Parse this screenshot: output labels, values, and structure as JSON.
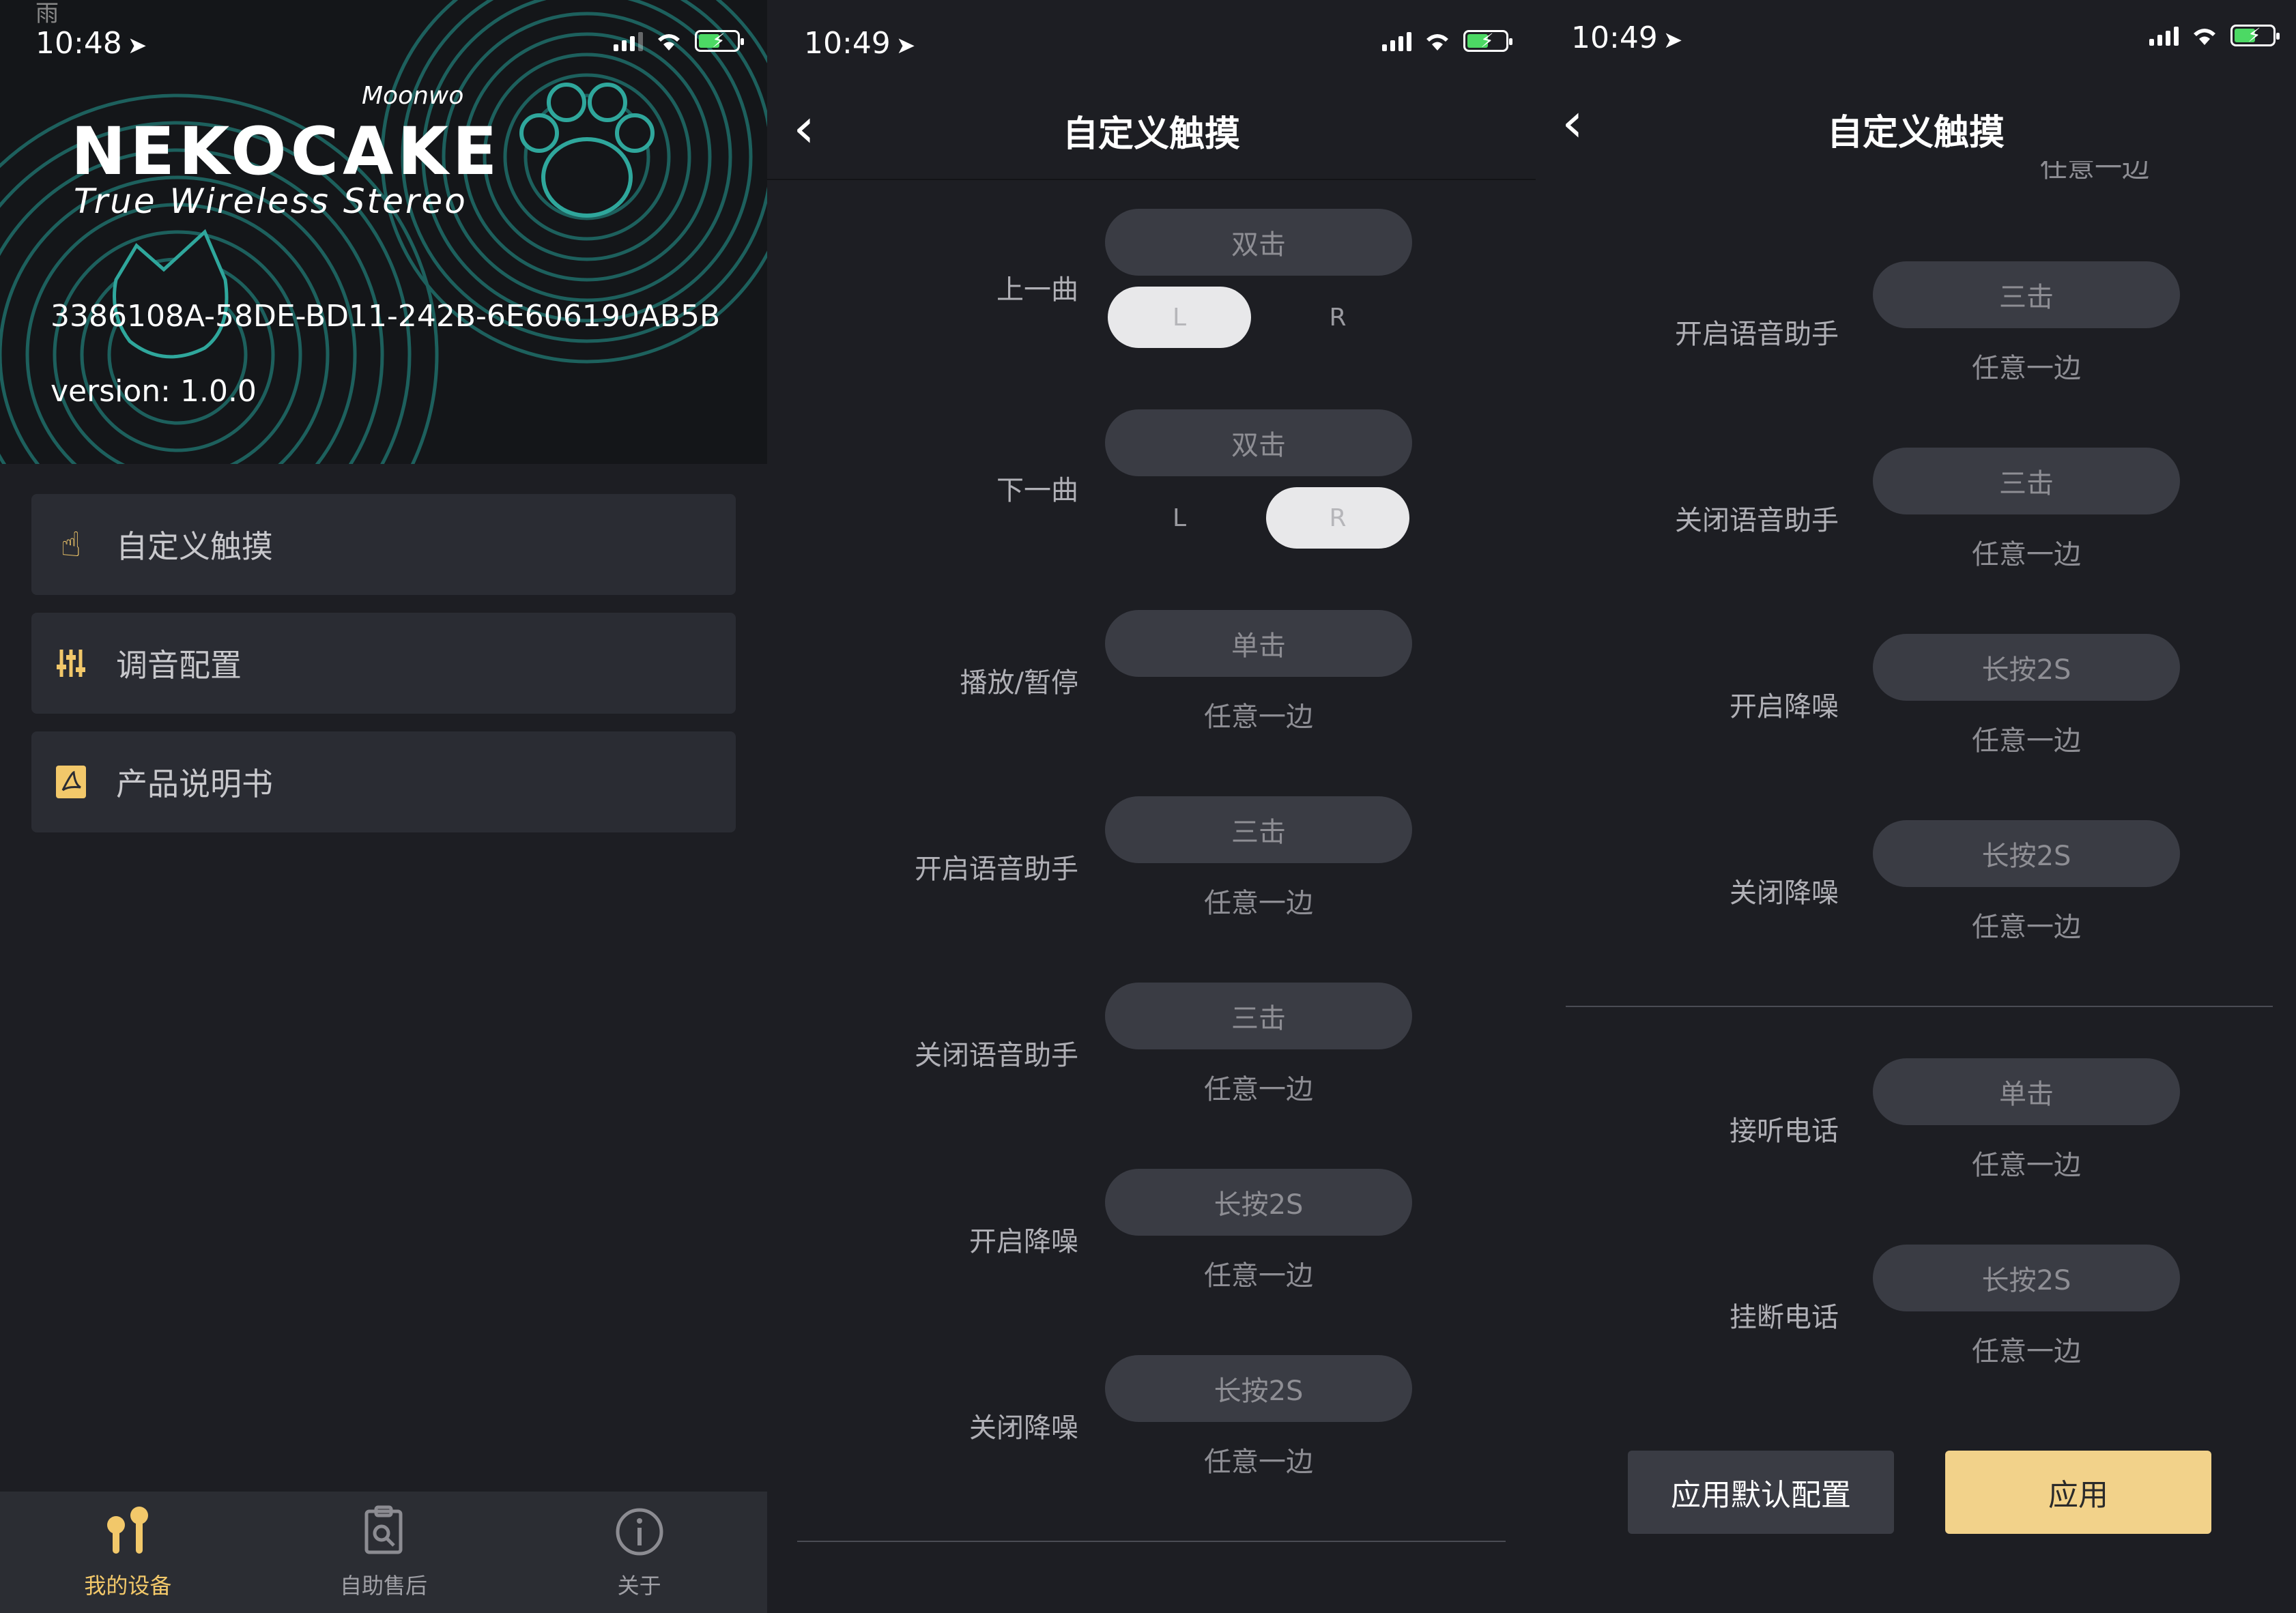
{
  "colors": {
    "accent": "#f2c86a",
    "apply_button": "#f2d28a",
    "panel_bg": "#1d1e23",
    "pill_bg": "#3a3c44"
  },
  "screen1": {
    "status": {
      "carrier": "雨",
      "time": "10:48"
    },
    "logo": {
      "brand": "NEKOCAKE",
      "tagline": "True Wireless Stereo",
      "signature": "Moonwo"
    },
    "device_id": "3386108A-58DE-BD11-242B-6E606190AB5B",
    "version": "version: 1.0.0",
    "menu": [
      {
        "label": "自定义触摸",
        "icon": "touch-hand-icon"
      },
      {
        "label": "调音配置",
        "icon": "equalizer-sliders-icon"
      },
      {
        "label": "产品说明书",
        "icon": "pdf-document-icon"
      }
    ],
    "tabs": [
      {
        "label": "我的设备",
        "icon": "earbuds-icon",
        "active": true
      },
      {
        "label": "自助售后",
        "icon": "service-clipboard-icon",
        "active": false
      },
      {
        "label": "关于",
        "icon": "info-circle-icon",
        "active": false
      }
    ]
  },
  "screen2": {
    "status": {
      "time": "10:49"
    },
    "title": "自定义触摸",
    "rows": [
      {
        "label": "上一曲",
        "gesture": "双击",
        "left": "L",
        "right": "R",
        "selected": "L"
      },
      {
        "label": "下一曲",
        "gesture": "双击",
        "left": "L",
        "right": "R",
        "selected": "R"
      },
      {
        "label": "播放/暂停",
        "gesture": "单击",
        "side": "任意一边"
      },
      {
        "label": "开启语音助手",
        "gesture": "三击",
        "side": "任意一边"
      },
      {
        "label": "关闭语音助手",
        "gesture": "三击",
        "side": "任意一边"
      },
      {
        "label": "开启降噪",
        "gesture": "长按2S",
        "side": "任意一边"
      },
      {
        "label": "关闭降噪",
        "gesture": "长按2S",
        "side": "任意一边"
      }
    ]
  },
  "screen3": {
    "status": {
      "time": "10:49"
    },
    "title": "自定义触摸",
    "clipped_top_text": "任意一边",
    "rows": [
      {
        "label": "开启语音助手",
        "gesture": "三击",
        "side": "任意一边"
      },
      {
        "label": "关闭语音助手",
        "gesture": "三击",
        "side": "任意一边"
      },
      {
        "label": "开启降噪",
        "gesture": "长按2S",
        "side": "任意一边"
      },
      {
        "label": "关闭降噪",
        "gesture": "长按2S",
        "side": "任意一边"
      },
      {
        "label": "接听电话",
        "gesture": "单击",
        "side": "任意一边"
      },
      {
        "label": "挂断电话",
        "gesture": "长按2S",
        "side": "任意一边"
      }
    ],
    "buttons": {
      "default_label": "应用默认配置",
      "apply_label": "应用"
    }
  }
}
